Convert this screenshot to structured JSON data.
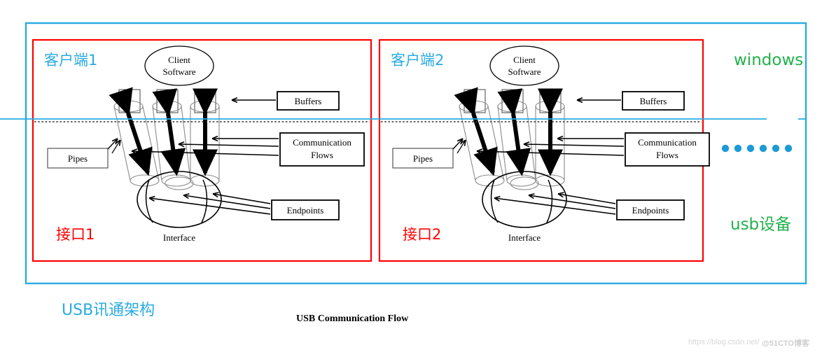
{
  "diagram": {
    "title_cn": "USB讯通架构",
    "caption_en": "USB Communication Flow",
    "outer_border_color": "#29abe2",
    "panel_border_color": "#ff0000",
    "host_label": "windows",
    "device_label": "usb设备",
    "host_device_color": "#22b14c",
    "boundary_line_color": "#29abe2",
    "dots_color": "#1b9ad6",
    "dots_count": 6,
    "panels": [
      {
        "client_label": "客户端1",
        "interface_label_cn": "接口1",
        "client_software": "Client\nSoftware",
        "client_software_line1": "Client",
        "client_software_line2": "Software",
        "buffers_label": "Buffers",
        "pipes_label": "Pipes",
        "comm_label_line1": "Communication",
        "comm_label_line2": "Flows",
        "endpoints_label": "Endpoints",
        "interface_label_en": "Interface",
        "pipe_count": 3
      },
      {
        "client_label": "客户端2",
        "interface_label_cn": "接口2",
        "client_software": "Client\nSoftware",
        "client_software_line1": "Client",
        "client_software_line2": "Software",
        "buffers_label": "Buffers",
        "pipes_label": "Pipes",
        "comm_label_line1": "Communication",
        "comm_label_line2": "Flows",
        "endpoints_label": "Endpoints",
        "interface_label_en": "Interface",
        "pipe_count": 3
      }
    ]
  },
  "watermark": {
    "url": "https://blog.csdn.net/",
    "handle": "@51CTO博客"
  }
}
